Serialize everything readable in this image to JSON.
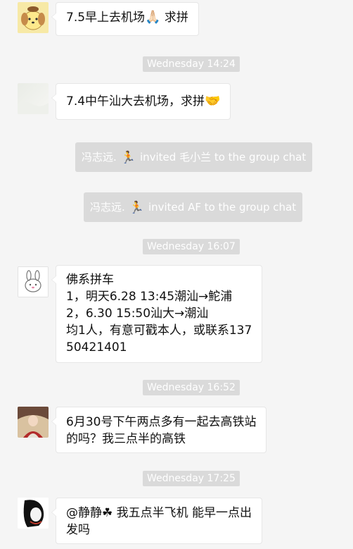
{
  "messages": [
    {
      "text": "7.5早上去机场",
      "emoji": "🙏🏻",
      "suffix": " 求拼"
    },
    {
      "text": "7.4中午汕大去机场，求拼",
      "emoji": "🤝"
    },
    {
      "lines": [
        "佛系拼车",
        "1，明天6.28 13:45潮汕→鮀浦",
        "2，6.30 15:50汕大→潮汕",
        "均1人，有意可戳本人，或联系137",
        "50421401"
      ]
    },
    {
      "lines": [
        "6月30号下午两点多有一起去高铁站",
        "的吗？我三点半的高铁"
      ]
    },
    {
      "lines": [
        "@静静☘ 我五点半飞机 能早一点出",
        "发吗"
      ]
    }
  ],
  "timestamps": [
    "Wednesday 14:24",
    "Wednesday 16:07",
    "Wednesday 16:52",
    "Wednesday 17:25"
  ],
  "system": [
    {
      "actor": "冯志远.",
      "emoji": "🏃",
      "text": "invited 毛小兰 to the group chat"
    },
    {
      "actor": "冯志远.",
      "emoji": "🏃",
      "text": "invited AF to the group chat"
    }
  ],
  "colors": {
    "background": "#f5f5f5",
    "bubble": "#ffffff",
    "timestamp_bg": "#dadada",
    "text": "#111111"
  }
}
